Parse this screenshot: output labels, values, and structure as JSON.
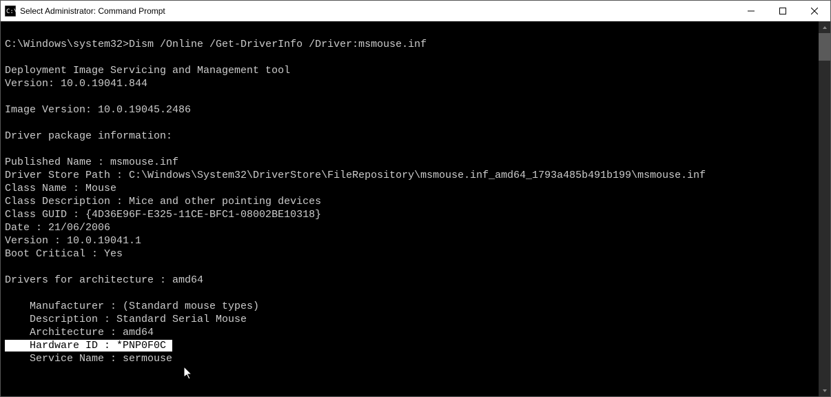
{
  "window": {
    "title": "Select Administrator: Command Prompt"
  },
  "terminal": {
    "prompt": "C:\\Windows\\system32>",
    "command": "Dism /Online /Get-DriverInfo /Driver:msmouse.inf",
    "tool_name": "Deployment Image Servicing and Management tool",
    "tool_version": "Version: 10.0.19041.844",
    "image_version": "Image Version: 10.0.19045.2486",
    "section_header": "Driver package information:",
    "published_name": "Published Name : msmouse.inf",
    "driver_store_path": "Driver Store Path : C:\\Windows\\System32\\DriverStore\\FileRepository\\msmouse.inf_amd64_1793a485b491b199\\msmouse.inf",
    "class_name": "Class Name : Mouse",
    "class_description": "Class Description : Mice and other pointing devices",
    "class_guid": "Class GUID : {4D36E96F-E325-11CE-BFC1-08002BE10318}",
    "date": "Date : 21/06/2006",
    "version": "Version : 10.0.19041.1",
    "boot_critical": "Boot Critical : Yes",
    "arch_header": "Drivers for architecture : amd64",
    "manufacturer": "    Manufacturer : (Standard mouse types)",
    "description": "    Description : Standard Serial Mouse",
    "architecture": "    Architecture : amd64",
    "hardware_id": "    Hardware ID : *PNP0F0C ",
    "service_name": "    Service Name : sermouse"
  }
}
